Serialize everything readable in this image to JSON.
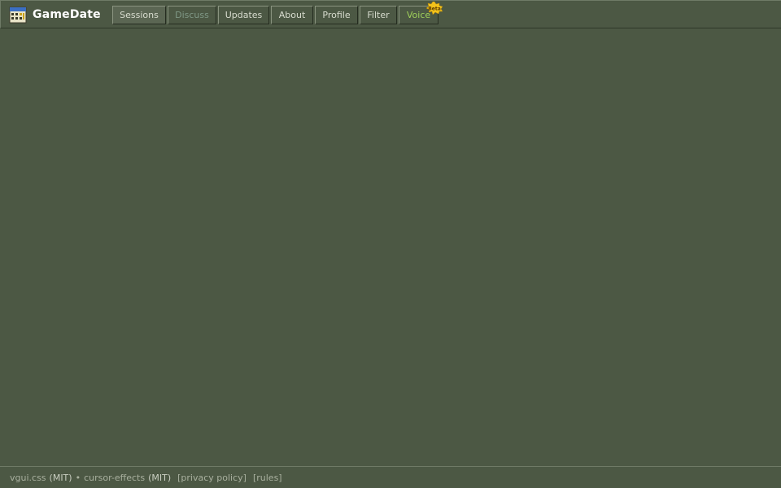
{
  "app": {
    "title": "GameDate",
    "logo_icon": "calendar-icon"
  },
  "nav": {
    "items": [
      {
        "label": "Sessions",
        "state": "active"
      },
      {
        "label": "Discuss",
        "state": "disabled"
      },
      {
        "label": "Updates",
        "state": "normal"
      },
      {
        "label": "About",
        "state": "normal"
      },
      {
        "label": "Profile",
        "state": "normal"
      },
      {
        "label": "Filter",
        "state": "normal"
      },
      {
        "label": "Voice",
        "state": "beta",
        "badge": "Beta"
      }
    ]
  },
  "footer": {
    "link1": "vgui.css",
    "license1": "(MIT)",
    "separator": "•",
    "link2": "cursor-effects",
    "license2": "(MIT)",
    "privacy": "[privacy policy]",
    "rules": "[rules]"
  },
  "colors": {
    "background": "#4c5844",
    "beta_text": "#9fcf5a",
    "badge": "#f2c21b"
  }
}
